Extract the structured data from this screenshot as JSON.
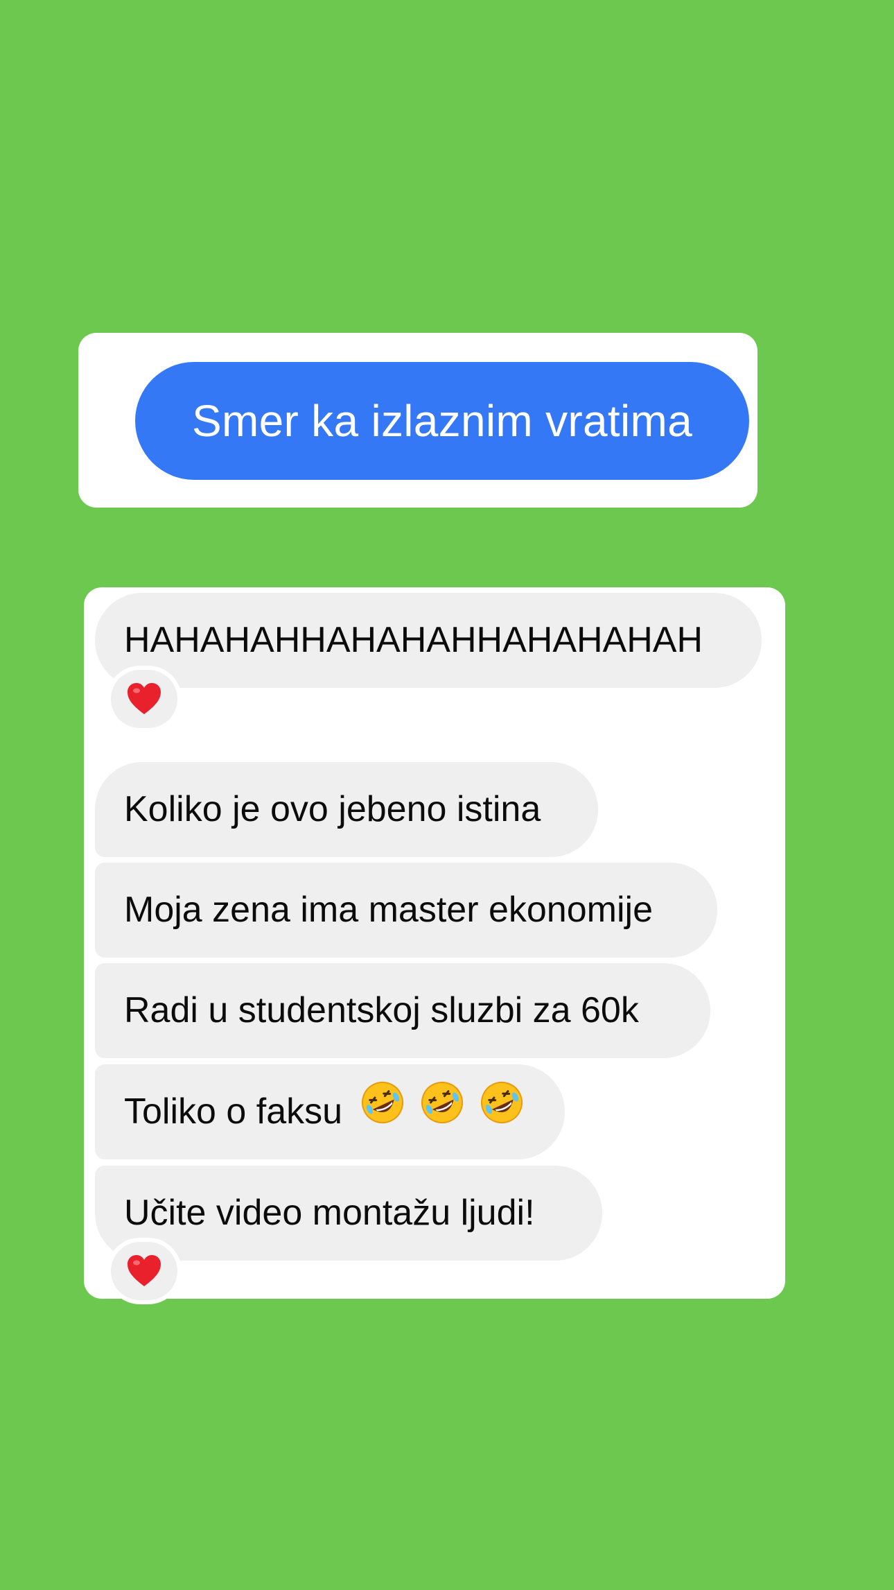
{
  "colors": {
    "background": "#6cc84f",
    "sent_bubble": "#3578f6",
    "received_bubble": "#efefef",
    "heart": "#e8212d"
  },
  "sent_message": {
    "text": "Smer ka izlaznim vratima"
  },
  "received_messages": [
    {
      "text": "HAHAHAHHAHAHAHHAHAHAHAH",
      "reaction": "heart-icon"
    },
    {
      "text": "Koliko je ovo jebeno istina"
    },
    {
      "text": "Moja zena ima master ekonomije"
    },
    {
      "text": "Radi u studentskoj sluzbi za 60k"
    },
    {
      "text": "Toliko o faksu",
      "emojis": [
        "rolling-on-floor-laughing-icon",
        "rolling-on-floor-laughing-icon",
        "rolling-on-floor-laughing-icon"
      ]
    },
    {
      "text": "Učite video montažu ljudi!",
      "reaction": "heart-icon"
    }
  ]
}
